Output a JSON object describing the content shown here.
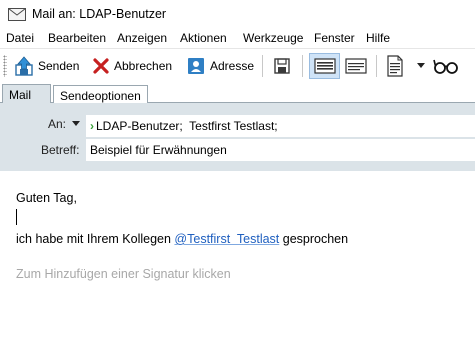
{
  "window": {
    "title": "Mail an: LDAP-Benutzer"
  },
  "menu": {
    "items": [
      "Datei",
      "Bearbeiten",
      "Anzeigen",
      "Aktionen",
      "Werkzeuge",
      "Fenster",
      "Hilfe"
    ]
  },
  "toolbar": {
    "send_label": "Senden",
    "cancel_label": "Abbrechen",
    "address_label": "Adresse",
    "icons": [
      "send-icon",
      "cancel-icon",
      "address-book-icon",
      "save-icon",
      "html-format-icon",
      "text-format-icon",
      "template-icon",
      "dropdown-arrow-icon",
      "spellcheck-glasses-icon"
    ]
  },
  "tabs": {
    "mail": "Mail",
    "send_options": "Sendeoptionen"
  },
  "header": {
    "to_label": "An:",
    "to_value": "LDAP-Benutzer;  Testfirst Testlast;",
    "subject_label": "Betreff:",
    "subject_value": "Beispiel für Erwähnungen"
  },
  "body": {
    "greeting": "Guten Tag,",
    "line_prefix": "ich habe mit Ihrem Kollegen ",
    "mention": "@Testfirst  Testlast",
    "line_suffix": " gesprochen",
    "signature_hint": "Zum Hinzufügen einer Signatur klicken"
  },
  "colors": {
    "header_bg": "#dbe3e8",
    "mention": "#1f5fbf",
    "signature_hint": "#a8a8a8",
    "recipient_chevron": "#3aa23a"
  }
}
